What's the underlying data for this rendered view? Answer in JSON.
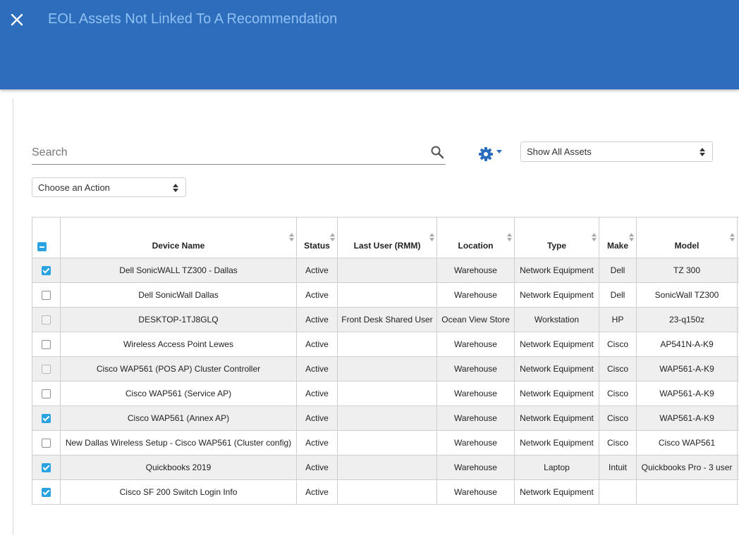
{
  "header": {
    "title": "EOL Assets Not Linked To A Recommendation",
    "close_icon": "close-icon"
  },
  "toolbar": {
    "search_placeholder": "Search",
    "search_value": "",
    "search_icon": "search-icon",
    "settings_icon": "gear-icon",
    "assets_filter": "Show All Assets",
    "action_select": "Choose an Action"
  },
  "table": {
    "columns": [
      "Device Name",
      "Status",
      "Last User (RMM)",
      "Location",
      "Type",
      "Make",
      "Model"
    ],
    "header_checkbox": "indeterminate",
    "rows": [
      {
        "checked": true,
        "device_name": "Dell SonicWALL TZ300 - Dallas",
        "status": "Active",
        "last_user": "",
        "location": "Warehouse",
        "type": "Network Equipment",
        "make": "Dell",
        "model": "TZ 300"
      },
      {
        "checked": false,
        "device_name": "Dell SonicWall Dallas",
        "status": "Active",
        "last_user": "",
        "location": "Warehouse",
        "type": "Network Equipment",
        "make": "Dell",
        "model": "SonicWall TZ300"
      },
      {
        "checked": false,
        "disabled": true,
        "device_name": "DESKTOP-1TJ8GLQ",
        "status": "Active",
        "last_user": "Front Desk Shared User",
        "location": "Ocean View Store",
        "type": "Workstation",
        "make": "HP",
        "model": "23-q150z"
      },
      {
        "checked": false,
        "device_name": "Wireless Access Point Lewes",
        "status": "Active",
        "last_user": "",
        "location": "Warehouse",
        "type": "Network Equipment",
        "make": "Cisco",
        "model": "AP541N-A-K9"
      },
      {
        "checked": false,
        "disabled": true,
        "device_name": "Cisco WAP561 (POS AP) Cluster Controller",
        "status": "Active",
        "last_user": "",
        "location": "Warehouse",
        "type": "Network Equipment",
        "make": "Cisco",
        "model": "WAP561-A-K9"
      },
      {
        "checked": false,
        "device_name": "Cisco WAP561 (Service AP)",
        "status": "Active",
        "last_user": "",
        "location": "Warehouse",
        "type": "Network Equipment",
        "make": "Cisco",
        "model": "WAP561-A-K9"
      },
      {
        "checked": true,
        "device_name": "Cisco WAP561 (Annex AP)",
        "status": "Active",
        "last_user": "",
        "location": "Warehouse",
        "type": "Network Equipment",
        "make": "Cisco",
        "model": "WAP561-A-K9"
      },
      {
        "checked": false,
        "device_name": "New Dallas Wireless Setup - Cisco WAP561 (Cluster config)",
        "status": "Active",
        "last_user": "",
        "location": "Warehouse",
        "type": "Network Equipment",
        "make": "Cisco",
        "model": "Cisco WAP561"
      },
      {
        "checked": true,
        "device_name": "Quickbooks 2019",
        "status": "Active",
        "last_user": "",
        "location": "Warehouse",
        "type": "Laptop",
        "make": "Intuit",
        "model": "Quickbooks Pro - 3 user"
      },
      {
        "checked": true,
        "device_name": "Cisco SF 200 Switch Login Info",
        "status": "Active",
        "last_user": "",
        "location": "Warehouse",
        "type": "Network Equipment",
        "make": "",
        "model": ""
      }
    ]
  },
  "colors": {
    "header_bg": "#2d6dbb",
    "title_text": "#8fc1f4",
    "link": "#2a6cbf",
    "checkbox_accent": "#2ba3e0",
    "row_stripe": "#efefef"
  }
}
